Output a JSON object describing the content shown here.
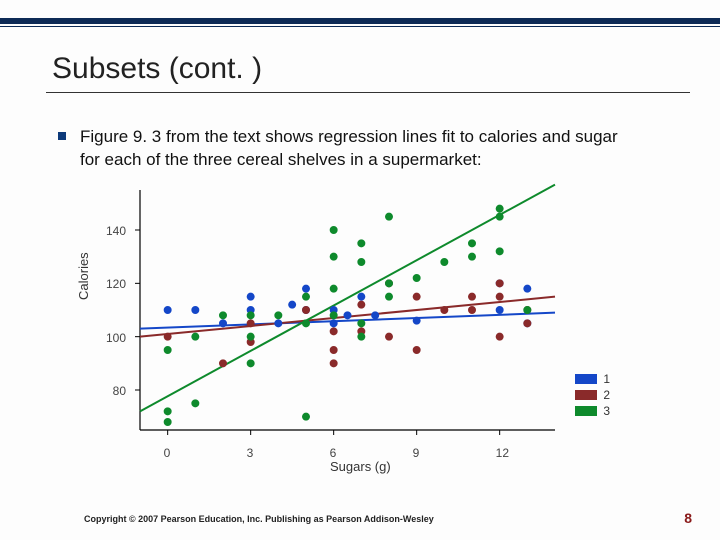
{
  "title": "Subsets (cont. )",
  "bullet": "Figure 9. 3 from the text shows regression lines fit to calories and sugar for each of the three cereal shelves in a supermarket:",
  "footer": "Copyright © 2007 Pearson Education, Inc. Publishing as Pearson Addison-Wesley",
  "page_number": "8",
  "chart_data": {
    "type": "scatter",
    "xlabel": "Sugars (g)",
    "ylabel": "Calories",
    "xlim": [
      -1,
      14
    ],
    "ylim": [
      65,
      155
    ],
    "xticks": [
      0,
      3,
      6,
      9,
      12
    ],
    "yticks": [
      80,
      100,
      120,
      140
    ],
    "regressions": [
      {
        "name": "1",
        "color": "#1447c8",
        "x1": -1,
        "y1": 103,
        "x2": 14,
        "y2": 109
      },
      {
        "name": "2",
        "color": "#8a2a2a",
        "x1": -1,
        "y1": 100,
        "x2": 14,
        "y2": 115
      },
      {
        "name": "3",
        "color": "#0e8a2c",
        "x1": -1,
        "y1": 72,
        "x2": 14,
        "y2": 157
      }
    ],
    "series": [
      {
        "name": "1",
        "color": "#1447c8",
        "points": [
          [
            0,
            110
          ],
          [
            1,
            110
          ],
          [
            2,
            105
          ],
          [
            3,
            110
          ],
          [
            3,
            115
          ],
          [
            4,
            105
          ],
          [
            4.5,
            112
          ],
          [
            5,
            110
          ],
          [
            5,
            118
          ],
          [
            6,
            105
          ],
          [
            6,
            110
          ],
          [
            6.5,
            108
          ],
          [
            7,
            115
          ],
          [
            7.5,
            108
          ],
          [
            9,
            106
          ],
          [
            12,
            120
          ],
          [
            12,
            110
          ],
          [
            13,
            118
          ],
          [
            13,
            105
          ]
        ]
      },
      {
        "name": "2",
        "color": "#8a2a2a",
        "points": [
          [
            0,
            100
          ],
          [
            2,
            90
          ],
          [
            3,
            98
          ],
          [
            3,
            105
          ],
          [
            5,
            110
          ],
          [
            6,
            90
          ],
          [
            6,
            95
          ],
          [
            6,
            102
          ],
          [
            7,
            102
          ],
          [
            7,
            112
          ],
          [
            8,
            100
          ],
          [
            8,
            120
          ],
          [
            9,
            115
          ],
          [
            9,
            95
          ],
          [
            10,
            110
          ],
          [
            11,
            110
          ],
          [
            11,
            115
          ],
          [
            12,
            115
          ],
          [
            12,
            120
          ],
          [
            13,
            105
          ],
          [
            13,
            110
          ],
          [
            12,
            100
          ]
        ]
      },
      {
        "name": "3",
        "color": "#0e8a2c",
        "points": [
          [
            0,
            68
          ],
          [
            0,
            72
          ],
          [
            0,
            95
          ],
          [
            1,
            100
          ],
          [
            1,
            75
          ],
          [
            2,
            108
          ],
          [
            3,
            90
          ],
          [
            3,
            100
          ],
          [
            3,
            108
          ],
          [
            4,
            108
          ],
          [
            5,
            105
          ],
          [
            5,
            115
          ],
          [
            5,
            70
          ],
          [
            6,
            108
          ],
          [
            6,
            118
          ],
          [
            6,
            130
          ],
          [
            6,
            140
          ],
          [
            7,
            105
          ],
          [
            7,
            100
          ],
          [
            7,
            128
          ],
          [
            7,
            135
          ],
          [
            8,
            115
          ],
          [
            8,
            120
          ],
          [
            8,
            145
          ],
          [
            9,
            122
          ],
          [
            10,
            128
          ],
          [
            11,
            130
          ],
          [
            11,
            135
          ],
          [
            12,
            132
          ],
          [
            12,
            148
          ],
          [
            12,
            145
          ],
          [
            13,
            110
          ]
        ]
      }
    ],
    "legend": [
      {
        "label": "1",
        "color": "#1447c8"
      },
      {
        "label": "2",
        "color": "#8a2a2a"
      },
      {
        "label": "3",
        "color": "#0e8a2c"
      }
    ]
  }
}
